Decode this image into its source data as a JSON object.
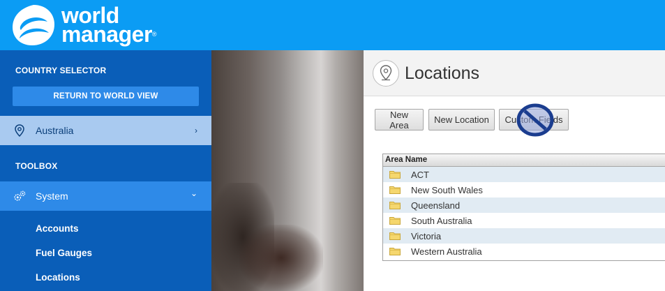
{
  "header": {
    "brand_line1": "world",
    "brand_line2": "manager",
    "brand_reg": "®"
  },
  "sidebar": {
    "country_selector_title": "COUNTRY SELECTOR",
    "return_button_label": "RETURN TO WORLD VIEW",
    "country_item": {
      "label": "Australia",
      "icon": "map-pin-icon",
      "chevron": "›"
    },
    "toolbox_title": "TOOLBOX",
    "system_item": {
      "label": "System",
      "icon": "gears-icon",
      "chevron": "⌄"
    },
    "system_subitems": [
      "Accounts",
      "Fuel Gauges",
      "Locations"
    ]
  },
  "main": {
    "title": "Locations",
    "title_icon": "location-pin-icon",
    "toolbar": {
      "new_area": "New Area",
      "new_location": "New Location",
      "custom_fields": "Custom Fields"
    },
    "grid": {
      "header": "Area Name",
      "rows": [
        "ACT",
        "New South Wales",
        "Queensland",
        "South Australia",
        "Victoria",
        "Western Australia"
      ]
    }
  },
  "colors": {
    "header_bg": "#0b9cf4",
    "sidebar_bg": "#0a5eb8",
    "sidebar_active": "#2e8ae8",
    "sidebar_country": "#a9caf0",
    "row_alt": "#e1ebf3"
  }
}
